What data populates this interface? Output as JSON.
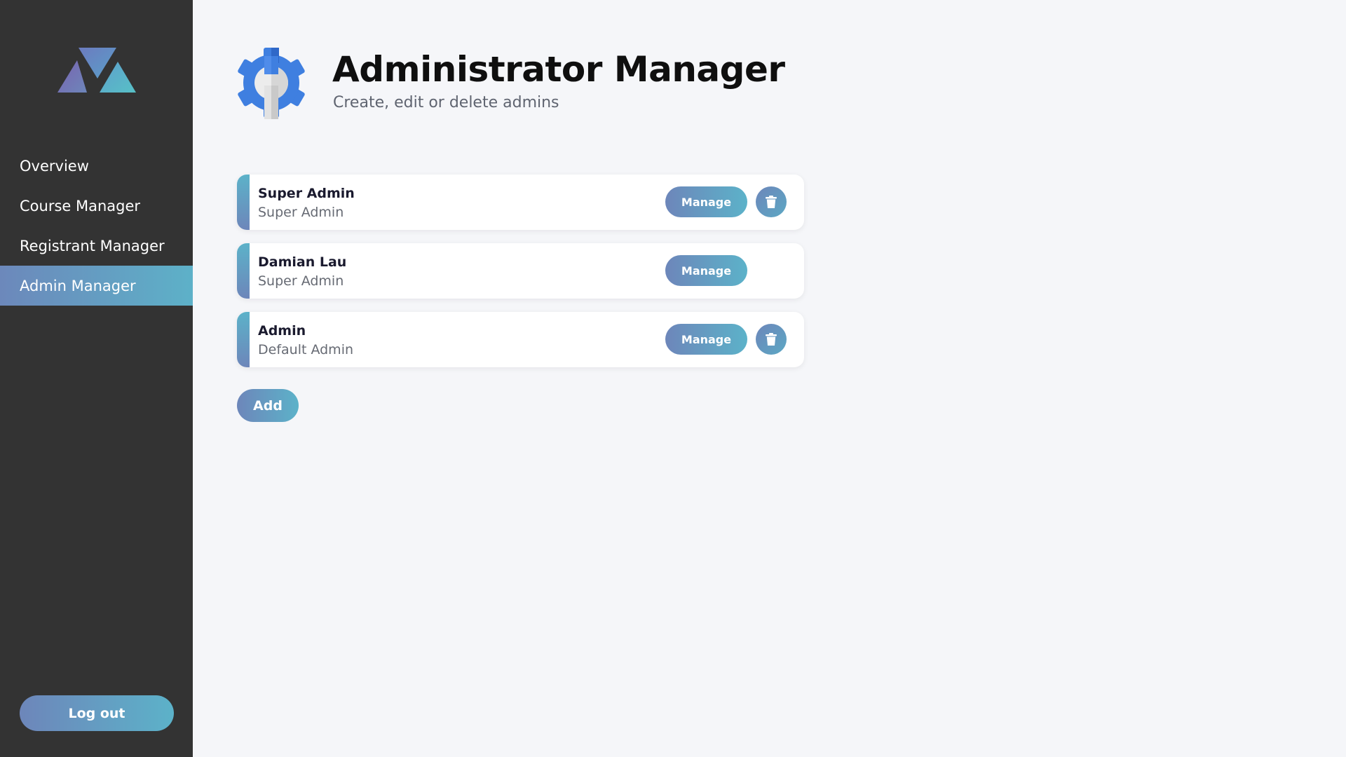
{
  "brand": {
    "logo_icon": "triangles-logo-icon"
  },
  "sidebar": {
    "items": [
      {
        "label": "Overview",
        "active": false
      },
      {
        "label": "Course Manager",
        "active": false
      },
      {
        "label": "Registrant Manager",
        "active": false
      },
      {
        "label": "Admin Manager",
        "active": true
      }
    ],
    "logout_label": "Log out"
  },
  "header": {
    "icon": "gear-wrench-icon",
    "title": "Administrator Manager",
    "subtitle": "Create, edit or delete admins"
  },
  "admins": [
    {
      "name": "Super Admin",
      "role": "Super Admin",
      "manage_label": "Manage",
      "deletable": true
    },
    {
      "name": "Damian Lau",
      "role": "Super Admin",
      "manage_label": "Manage",
      "deletable": false
    },
    {
      "name": "Admin",
      "role": "Default Admin",
      "manage_label": "Manage",
      "deletable": true
    }
  ],
  "add_label": "Add",
  "colors": {
    "sidebar_bg": "#333333",
    "accent_start": "#6d86ba",
    "accent_end": "#5cb2c9",
    "page_bg": "#f5f6f9"
  }
}
